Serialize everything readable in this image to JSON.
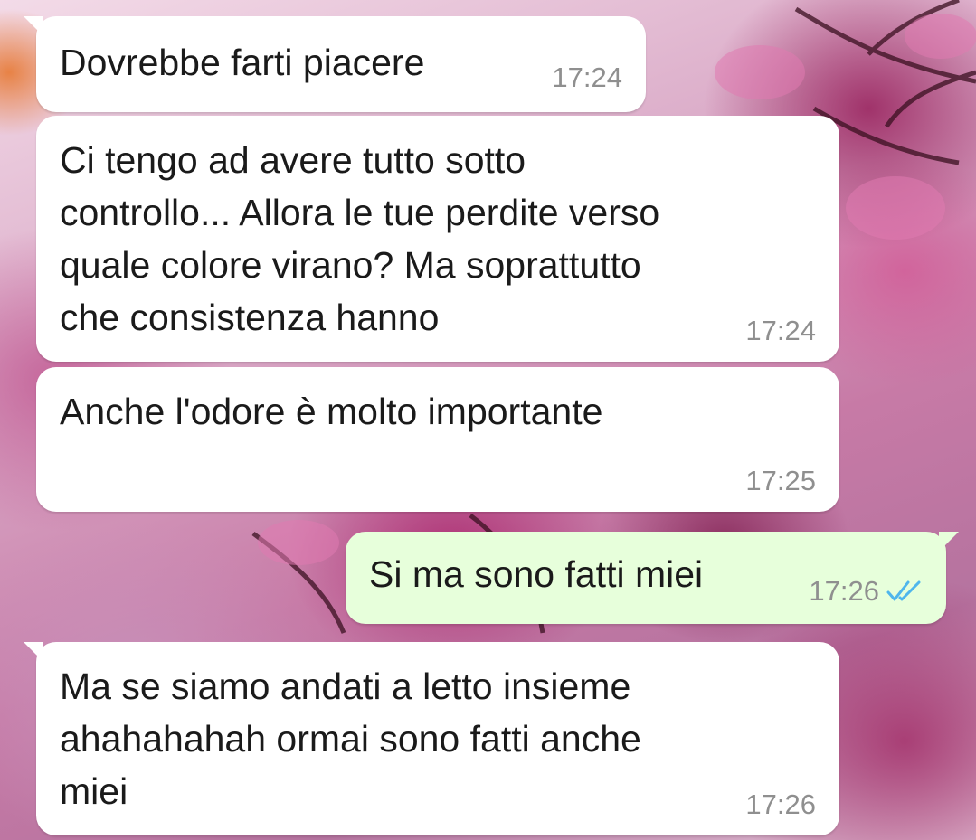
{
  "colors": {
    "incoming_bubble": "#ffffff",
    "outgoing_bubble": "#e7ffdb",
    "timestamp": "#8f8f8f",
    "read_receipt": "#4fb6ec"
  },
  "messages": [
    {
      "direction": "incoming",
      "text": "Dovrebbe farti piacere",
      "time": "17:24"
    },
    {
      "direction": "incoming",
      "text": "Ci tengo ad avere tutto sotto\ncontrollo... Allora le tue perdite verso\nquale colore virano? Ma soprattutto\nche consistenza hanno",
      "time": "17:24"
    },
    {
      "direction": "incoming",
      "text": "Anche l'odore è molto importante",
      "time": "17:25"
    },
    {
      "direction": "outgoing",
      "text": "Si ma sono fatti miei",
      "time": "17:26",
      "status_icon": "double-check-icon",
      "status": "read"
    },
    {
      "direction": "incoming",
      "text": "Ma se siamo andati a letto insieme\nahahahahah ormai sono fatti anche\nmiei",
      "time": "17:26"
    }
  ]
}
